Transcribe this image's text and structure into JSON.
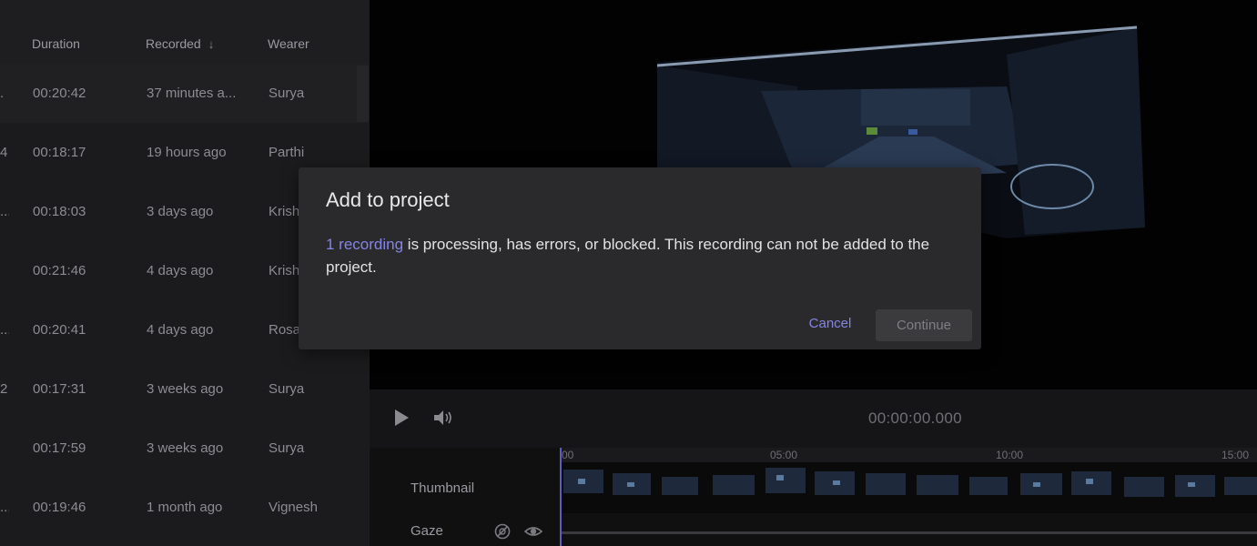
{
  "recordings_table": {
    "columns": {
      "duration": "Duration",
      "recorded": "Recorded",
      "wearer": "Wearer",
      "sort_icon": "arrow-down-icon"
    },
    "rows": [
      {
        "name_fragment": ".",
        "duration": "00:20:42",
        "recorded": "37 minutes a...",
        "wearer": "Surya"
      },
      {
        "name_fragment": "4",
        "duration": "00:18:17",
        "recorded": "19 hours ago",
        "wearer": "Parthi"
      },
      {
        "name_fragment": "...",
        "duration": "00:18:03",
        "recorded": "3 days ago",
        "wearer": "Krish"
      },
      {
        "name_fragment": "",
        "duration": "00:21:46",
        "recorded": "4 days ago",
        "wearer": "Krish"
      },
      {
        "name_fragment": "...",
        "duration": "00:20:41",
        "recorded": "4 days ago",
        "wearer": "Rosa"
      },
      {
        "name_fragment": "2",
        "duration": "00:17:31",
        "recorded": "3 weeks ago",
        "wearer": "Surya"
      },
      {
        "name_fragment": "",
        "duration": "00:17:59",
        "recorded": "3 weeks ago",
        "wearer": "Surya"
      },
      {
        "name_fragment": "...",
        "duration": "00:19:46",
        "recorded": "1 month ago",
        "wearer": "Vignesh"
      }
    ]
  },
  "player": {
    "timecode": "00:00:00.000",
    "play_icon": "play-icon",
    "volume_icon": "volume-icon",
    "timeline": {
      "ticks": [
        "00",
        "05:00",
        "10:00",
        "15:00"
      ],
      "tracks": {
        "thumbnail": "Thumbnail",
        "gaze": "Gaze"
      },
      "gaze_icons": [
        "visibility-off-icon",
        "eye-icon"
      ]
    }
  },
  "modal": {
    "title": "Add to project",
    "link_text": "1 recording",
    "message": " is processing, has errors, or blocked. This recording can not be added to the project.",
    "cancel_label": "Cancel",
    "continue_label": "Continue"
  },
  "colors": {
    "accent": "#8585e6",
    "modal_bg": "#2a2a2c",
    "table_bg": "#1b1b1d"
  }
}
